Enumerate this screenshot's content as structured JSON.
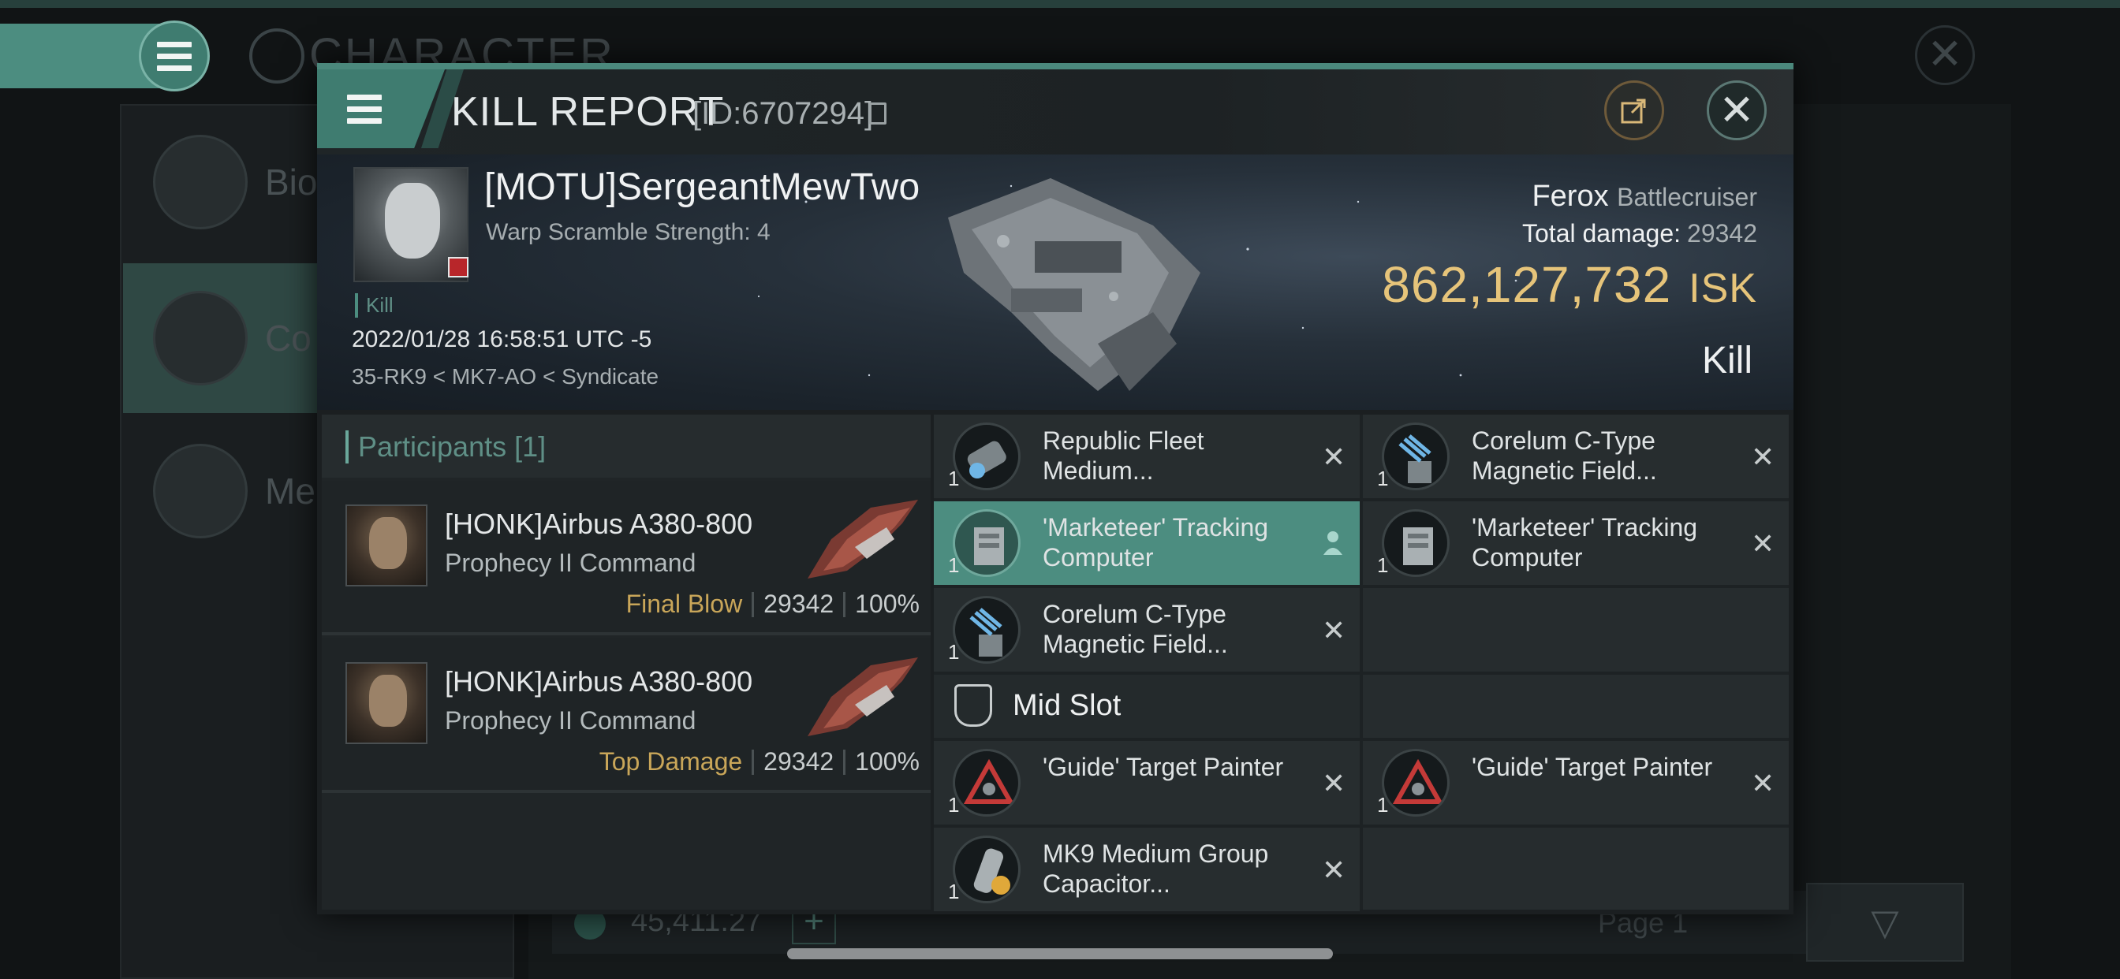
{
  "background": {
    "screen_title": "CHARACTER",
    "sidebar": [
      {
        "label": "Bio",
        "icon": "list-icon"
      },
      {
        "label": "Co",
        "icon": "crossed-swords-icon"
      },
      {
        "label": "Me",
        "icon": "star-badge-icon"
      }
    ],
    "wallet_amount": "45,411.27",
    "page_label": "Page 1"
  },
  "dialog": {
    "title": "KILL REPORT",
    "report_id": "[ID:6707294]"
  },
  "victim": {
    "name": "[MOTU]SergeantMewTwo",
    "subtitle": "Warp Scramble Strength: 4",
    "tag": "Kill",
    "datetime": "2022/01/28 16:58:51 UTC -5",
    "location": "35-RK9 < MK7-AO < Syndicate",
    "ship_name": "Ferox",
    "ship_class": "Battlecruiser",
    "total_damage_label": "Total damage:",
    "total_damage": "29342",
    "isk_value": "862,127,732",
    "isk_unit": "ISK",
    "result": "Kill"
  },
  "participants": {
    "header": "Participants [1]",
    "rows": [
      {
        "name": "[HONK]Airbus A380-800",
        "ship": "Prophecy II Command",
        "tag": "Final Blow",
        "damage": "29342",
        "percent": "100%"
      },
      {
        "name": "[HONK]Airbus A380-800",
        "ship": "Prophecy II Command",
        "tag": "Top Damage",
        "damage": "29342",
        "percent": "100%"
      }
    ]
  },
  "modules": {
    "high": [
      {
        "name": "Republic Fleet Medium...",
        "qty": "1",
        "icon": "blaster-icon"
      },
      {
        "name": "Corelum C-Type Magnetic Field...",
        "qty": "1",
        "icon": "magnetic-field-icon"
      },
      {
        "name": "'Marketeer' Tracking Computer",
        "qty": "1",
        "icon": "tracking-computer-icon"
      },
      {
        "name": "'Marketeer' Tracking Computer",
        "qty": "1",
        "icon": "tracking-computer-icon"
      },
      {
        "name": "Corelum C-Type Magnetic Field...",
        "qty": "1",
        "icon": "magnetic-field-icon"
      }
    ],
    "mid_slot_label": "Mid Slot",
    "mid": [
      {
        "name": "'Guide' Target Painter",
        "qty": "1",
        "icon": "target-painter-icon"
      },
      {
        "name": "'Guide' Target Painter",
        "qty": "1",
        "icon": "target-painter-icon"
      },
      {
        "name": "MK9 Medium Group Capacitor...",
        "qty": "1",
        "icon": "capacitor-icon"
      }
    ]
  },
  "colors": {
    "accent": "#4c8d80",
    "isk_gold": "#e6c47a",
    "tag_gold": "#c9a659",
    "danger_badge": "#b8262a"
  }
}
